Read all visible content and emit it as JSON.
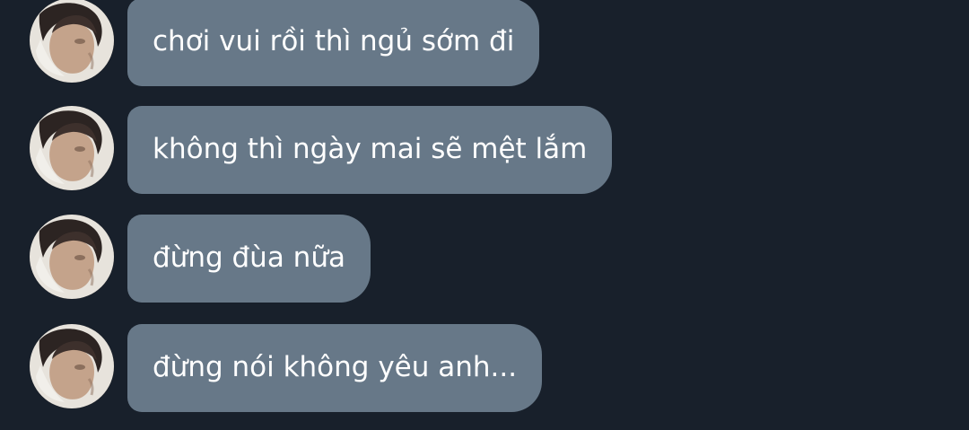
{
  "chat": {
    "messages": [
      {
        "text": "chơi vui rồi thì ngủ sớm đi",
        "avatar_icon": "profile-avatar"
      },
      {
        "text": "không thì ngày mai sẽ mệt lắm",
        "avatar_icon": "profile-avatar"
      },
      {
        "text": "đừng đùa nữa",
        "avatar_icon": "profile-avatar"
      },
      {
        "text": "đừng nói không yêu anh...",
        "avatar_icon": "profile-avatar"
      }
    ],
    "colors": {
      "background": "#18202b",
      "bubble": "#677888",
      "text": "#ffffff"
    }
  }
}
